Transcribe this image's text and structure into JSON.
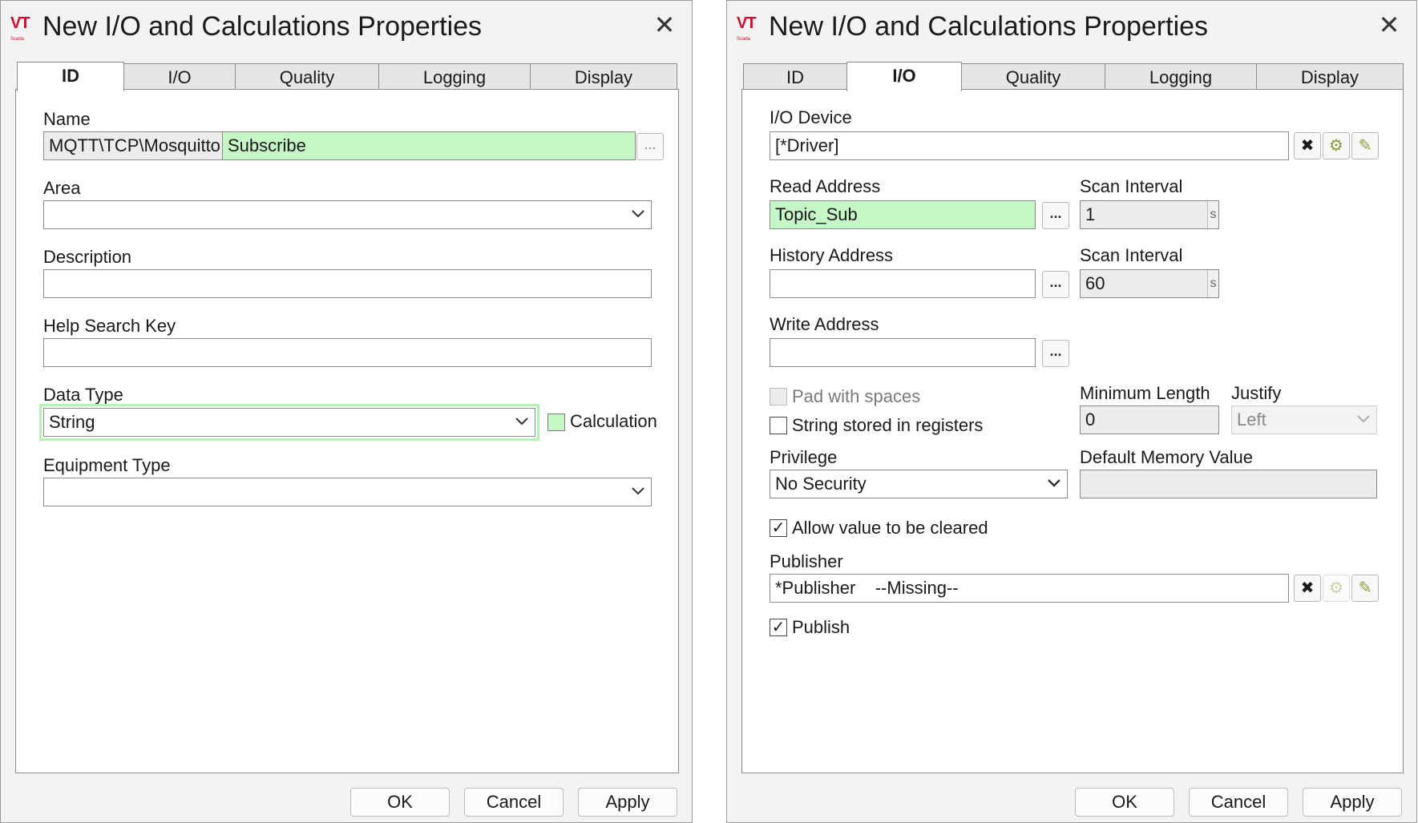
{
  "left": {
    "title": "New I/O and Calculations Properties",
    "logo": "VT",
    "logo_sub": "Scada",
    "tabs": [
      "ID",
      "I/O",
      "Quality",
      "Logging",
      "Display"
    ],
    "active_tab": "ID",
    "name_label": "Name",
    "name_prefix": "MQTT\\TCP\\Mosquitto",
    "name_value": "Subscribe",
    "area_label": "Area",
    "area_value": "",
    "description_label": "Description",
    "description_value": "",
    "help_key_label": "Help Search Key",
    "help_key_value": "",
    "data_type_label": "Data Type",
    "data_type_value": "String",
    "calculation_label": "Calculation",
    "equipment_label": "Equipment Type",
    "equipment_value": "",
    "buttons": {
      "ok": "OK",
      "cancel": "Cancel",
      "apply": "Apply"
    }
  },
  "right": {
    "title": "New I/O and Calculations Properties",
    "logo": "VT",
    "logo_sub": "Scada",
    "tabs": [
      "ID",
      "I/O",
      "Quality",
      "Logging",
      "Display"
    ],
    "active_tab": "I/O",
    "io_device_label": "I/O Device",
    "io_device_value": "[*Driver]",
    "read_address_label": "Read Address",
    "read_address_value": "Topic_Sub",
    "scan_interval_label_1": "Scan Interval",
    "scan_interval_value_1": "1",
    "history_address_label": "History Address",
    "history_address_value": "",
    "scan_interval_label_2": "Scan Interval",
    "scan_interval_value_2": "60",
    "unit_s": "s",
    "write_address_label": "Write Address",
    "write_address_value": "",
    "pad_spaces_label": "Pad with spaces",
    "pad_spaces_checked": false,
    "string_registers_label": "String stored in registers",
    "string_registers_checked": false,
    "min_length_label": "Minimum Length",
    "min_length_value": "0",
    "justify_label": "Justify",
    "justify_value": "Left",
    "privilege_label": "Privilege",
    "privilege_value": "No Security",
    "default_memory_label": "Default Memory Value",
    "default_memory_value": "",
    "allow_clear_label": "Allow value to be cleared",
    "allow_clear_checked": true,
    "publisher_label": "Publisher",
    "publisher_value": "*Publisher    --Missing--",
    "publish_label": "Publish",
    "publish_checked": true,
    "buttons": {
      "ok": "OK",
      "cancel": "Cancel",
      "apply": "Apply"
    }
  }
}
